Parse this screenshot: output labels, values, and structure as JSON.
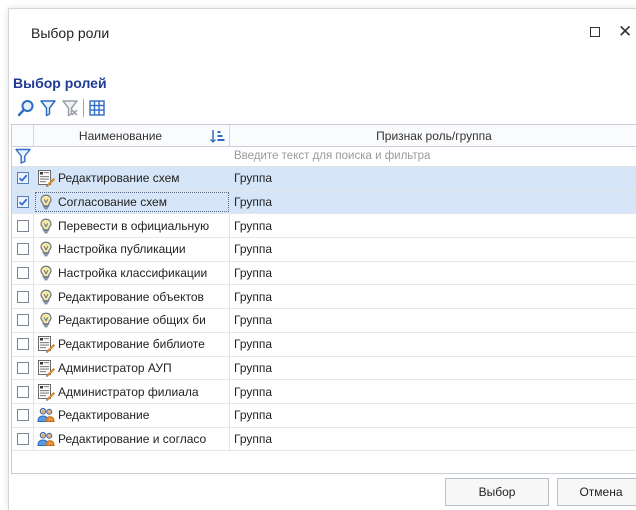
{
  "window": {
    "title": "Выбор роли"
  },
  "section_title": "Выбор ролей",
  "toolbar": {
    "buttons": [
      "search-icon",
      "filter-icon",
      "clear-filter-icon",
      "column-chooser-icon"
    ]
  },
  "grid": {
    "columns": {
      "name": "Наименование",
      "type": "Признак роль/группа"
    },
    "filter_placeholder": "Введите текст для поиска и фильтра",
    "rows": [
      {
        "name": "Редактирование схем",
        "type": "Группа",
        "checked": true,
        "icon": "document-edit-icon"
      },
      {
        "name": "Согласование схем",
        "type": "Группа",
        "checked": true,
        "icon": "lightbulb-icon"
      },
      {
        "name": "Перевести в официальную",
        "type": "Группа",
        "checked": false,
        "icon": "lightbulb-icon"
      },
      {
        "name": "Настройка публикации",
        "type": "Группа",
        "checked": false,
        "icon": "lightbulb-icon"
      },
      {
        "name": "Настройка классификации",
        "type": "Группа",
        "checked": false,
        "icon": "lightbulb-icon"
      },
      {
        "name": "Редактирование объектов",
        "type": "Группа",
        "checked": false,
        "icon": "lightbulb-icon"
      },
      {
        "name": "Редактирование общих би",
        "type": "Группа",
        "checked": false,
        "icon": "lightbulb-icon"
      },
      {
        "name": "Редактирование библиоте",
        "type": "Группа",
        "checked": false,
        "icon": "document-edit-icon"
      },
      {
        "name": "Администратор АУП",
        "type": "Группа",
        "checked": false,
        "icon": "document-edit-icon"
      },
      {
        "name": "Администратор филиала",
        "type": "Группа",
        "checked": false,
        "icon": "document-edit-icon"
      },
      {
        "name": "Редактирование",
        "type": "Группа",
        "checked": false,
        "icon": "users-icon"
      },
      {
        "name": "Редактирование и согласо",
        "type": "Группа",
        "checked": false,
        "icon": "users-icon"
      }
    ]
  },
  "footer": {
    "select_label": "Выбор",
    "cancel_label": "Отмена"
  },
  "colors": {
    "accent": "#1f3a93",
    "selected_row": "#d6e6f8",
    "checkbox_check": "#2f6fcf"
  }
}
